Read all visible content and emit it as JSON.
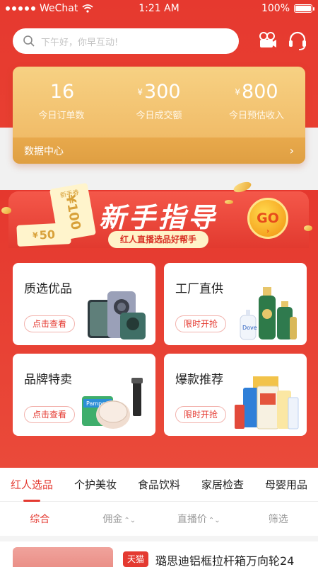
{
  "status_bar": {
    "carrier": "WeChat",
    "time": "1:21 AM",
    "battery": "100%"
  },
  "search": {
    "placeholder": "下午好，你早互动!"
  },
  "stats": {
    "items": [
      {
        "value": "16",
        "currency": "",
        "label": "今日订单数"
      },
      {
        "value": "300",
        "currency": "¥",
        "label": "今日成交额"
      },
      {
        "value": "800",
        "currency": "¥",
        "label": "今日预估收入"
      }
    ],
    "footer_label": "数据中心"
  },
  "banner": {
    "title": "新手指导",
    "subtitle": "红人直播选品好帮手",
    "go_label": "GO",
    "ticket100_top": "新手券",
    "ticket100_value": "¥100",
    "ticket50_currency": "¥",
    "ticket50_value": "50"
  },
  "cards": [
    {
      "title": "质选优品",
      "button": "点击查看"
    },
    {
      "title": "工厂直供",
      "button": "限时开抢"
    },
    {
      "title": "品牌特卖",
      "button": "点击查看"
    },
    {
      "title": "爆款推荐",
      "button": "限时开抢"
    }
  ],
  "category_tabs": [
    "红人选品",
    "个护美妆",
    "食品饮料",
    "家居检查",
    "母婴用品"
  ],
  "sort_options": [
    {
      "label": "综合",
      "arrow": ""
    },
    {
      "label": "佣金",
      "arrow": "⌃⌄"
    },
    {
      "label": "直播价",
      "arrow": "⌃⌄"
    },
    {
      "label": "筛选",
      "arrow": ""
    }
  ],
  "product": {
    "tag": "天猫",
    "name": "璐思迪铝框拉杆箱万向轮24"
  },
  "colors": {
    "primary_red": "#e43a31",
    "gold": "#eeb45e"
  }
}
